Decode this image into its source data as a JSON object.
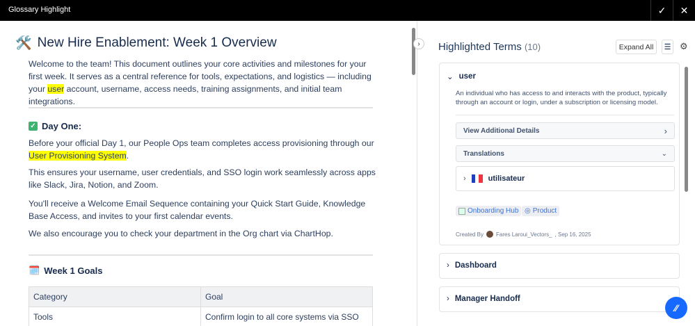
{
  "app": {
    "title": "Glossary Highlight"
  },
  "doc": {
    "title": "New Hire Enablement: Week 1 Overview",
    "intro_a": "Welcome to the team! This document outlines your core activities and milestones for your first week. It serves as a central reference for tools, expectations, and logistics — including your ",
    "intro_hl": "user",
    "intro_b": " account, username, access needs, training assignments, and initial team integrations.",
    "day_one_heading": "Day One:",
    "p1_a": "Before your official Day 1, our People Ops team completes access provisioning through our ",
    "p1_hl": "User Provisioning System",
    "p1_b": ".",
    "p2": "This ensures your username, user credentials, and SSO login work seamlessly across apps like Slack, Jira, Notion, and Zoom.",
    "p3": "You'll receive a Welcome Email Sequence containing your Quick Start Guide, Knowledge Base Access, and invites to your first calendar events.",
    "p4": "We also encourage you to check your department in the Org chart via ChartHop.",
    "goals_heading": "Week 1 Goals",
    "table": {
      "headers": [
        "Category",
        "Goal"
      ],
      "rows": [
        [
          "Tools",
          "Confirm login to all core systems via SSO"
        ]
      ]
    }
  },
  "panel": {
    "title": "Highlighted Terms",
    "count": "(10)",
    "expand_all": "Expand All",
    "terms": [
      {
        "name": "user",
        "description": "An individual who has access to and interacts with the product, typically through an account or login, under a subscription or licensing model.",
        "additional": "View Additional Details",
        "translations": "Translations",
        "translation": "utilisateur",
        "tags": [
          "Onboarding Hub",
          "Product"
        ],
        "created_by_label": "Created By",
        "author": "Fares Laroui_Vectors_",
        "date": ", Sep 16, 2025"
      },
      {
        "name": "Dashboard"
      },
      {
        "name": "Manager Handoff"
      }
    ]
  }
}
